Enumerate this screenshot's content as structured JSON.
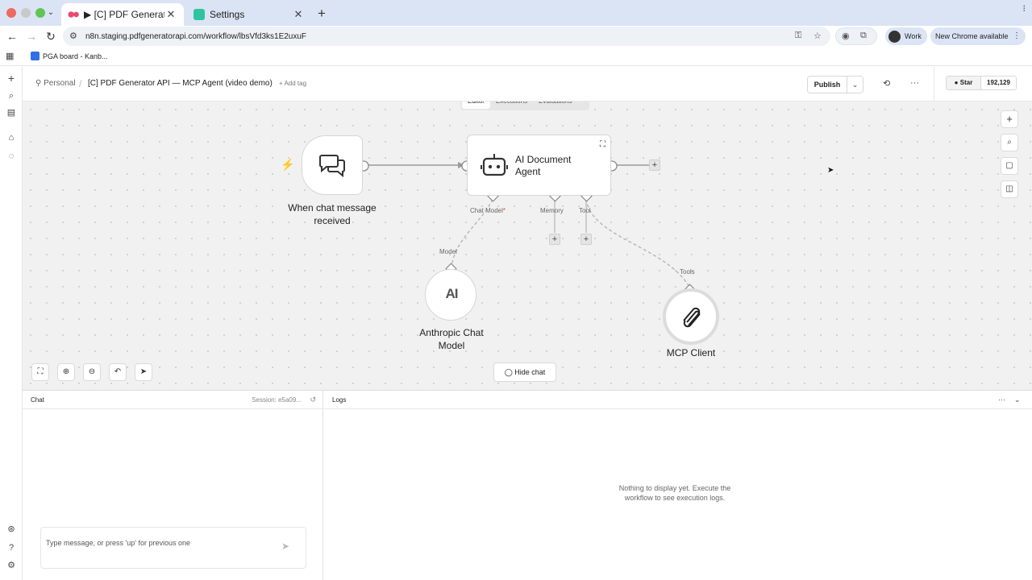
{
  "browser": {
    "tabs": [
      {
        "title": "[C] PDF Generator API – M",
        "active": true,
        "play_indicator": "▶"
      },
      {
        "title": "Settings",
        "active": false
      }
    ],
    "url": "n8n.staging.pdfgeneratorapi.com/workflow/lbsVfd3ks1E2uxuF",
    "profile_label": "Work",
    "update_label": "New Chrome available",
    "bookmarks": [
      {
        "label": "PGA board - Kanb..."
      }
    ]
  },
  "header": {
    "breadcrumb_personal": "Personal",
    "workflow_title": "[C] PDF Generator API — MCP Agent (video demo)",
    "add_tag": "+ Add tag",
    "publish_label": "Publish",
    "github_star_label": "Star",
    "github_star_count": "192,129"
  },
  "view_tabs": [
    {
      "label": "Editor",
      "selected": true
    },
    {
      "label": "Executions",
      "selected": false
    },
    {
      "label": "Evaluations",
      "selected": false
    }
  ],
  "nodes": {
    "trigger": {
      "label_line1": "When chat message",
      "label_line2": "received"
    },
    "agent": {
      "label_line1": "AI Document",
      "label_line2": "Agent"
    },
    "model": {
      "label_line1": "Anthropic Chat",
      "label_line2": "Model",
      "logo_text": "AI"
    },
    "mcp": {
      "label": "MCP Client"
    }
  },
  "ports": {
    "chat_model": "Chat Model",
    "chat_model_required": "*",
    "memory": "Memory",
    "tool": "Tool",
    "model": "Model",
    "tools": "Tools"
  },
  "canvas": {
    "hide_chat_label": "Hide chat"
  },
  "chat": {
    "title": "Chat",
    "session": "Session: e5a09...",
    "placeholder": "Type message, or press 'up' for previous one"
  },
  "logs": {
    "title": "Logs",
    "empty_line1": "Nothing to display yet. Execute the",
    "empty_line2": "workflow to see execution logs."
  },
  "colors": {
    "canvas_bg": "#f1f1f1",
    "trigger_bolt": "#e86b5a",
    "required_marker": "#e04a4a",
    "tab_strip": "#dbe4f4"
  }
}
